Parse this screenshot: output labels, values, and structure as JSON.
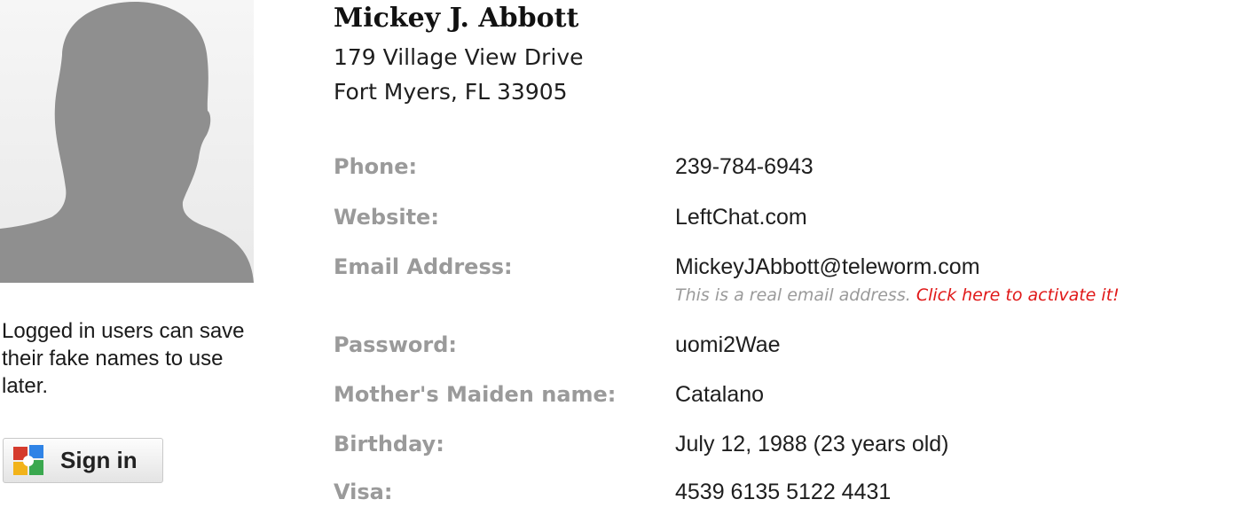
{
  "sidebar": {
    "avatar_icon": "person-silhouette-icon",
    "login_note": "Logged in users can save their fake names to use later.",
    "signin": {
      "icon": "google-icon",
      "label": "Sign in"
    }
  },
  "person": {
    "name": "Mickey J. Abbott",
    "address_line1": "179 Village View Drive",
    "address_line2": "Fort Myers, FL 33905"
  },
  "details": {
    "phone": {
      "label": "Phone:",
      "value": "239-784-6943"
    },
    "website": {
      "label": "Website:",
      "value": "LeftChat.com"
    },
    "email": {
      "label": "Email Address:",
      "value": "MickeyJAbbott@teleworm.com",
      "note": "This is a real email address.",
      "note_link": "Click here to activate it!"
    },
    "password": {
      "label": "Password:",
      "value": "uomi2Wae"
    },
    "maiden": {
      "label": "Mother's Maiden name:",
      "value": "Catalano"
    },
    "birthday": {
      "label": "Birthday:",
      "value": "July 12, 1988 (23 years old)"
    },
    "visa": {
      "label": "Visa:",
      "value": "4539 6135 5122 4431"
    }
  },
  "colors": {
    "label_gray": "#9a9a9a",
    "link_red": "#e01818",
    "avatar_silhouette": "#8f8f8f"
  }
}
